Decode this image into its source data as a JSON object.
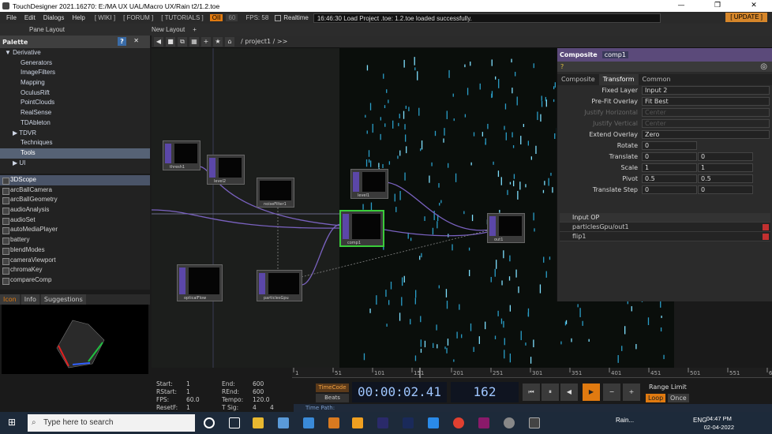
{
  "window": {
    "title": "TouchDesigner 2021.16270: E:/MA UX UAL/Macro UX/Rain t2/1.2.toe",
    "minimize": "—",
    "maximize": "❐",
    "close": "✕"
  },
  "menu": {
    "file": "File",
    "edit": "Edit",
    "dialogs": "Dialogs",
    "help": "Help",
    "wiki": "[ WIKI ]",
    "forum": "[ FORUM ]",
    "tutorials": "[ TUTORIALS ]",
    "oii": "OII",
    "sixty": "60",
    "fps": "FPS: 58",
    "realtime": "Realtime",
    "status": "16:46:30 Load Project .toe: 1.2.toe loaded successfully.",
    "update": "[ UPDATE ]"
  },
  "toolbar": {
    "pane_layout": "Pane Layout",
    "new_layout": "New Layout",
    "plus": "+"
  },
  "path": {
    "text": "/ project1 / >>"
  },
  "palette": {
    "title": "Palette",
    "q": "?",
    "groups": [
      {
        "label": "Derivative",
        "indent": "group"
      }
    ],
    "items": [
      "Generators",
      "ImageFilters",
      "Mapping",
      "OculusRift",
      "PointClouds",
      "RealSense",
      "TDAbleton"
    ],
    "tdvr": "TDVR",
    "techniques": "Techniques",
    "tools": "Tools",
    "ui": "UI"
  },
  "components": [
    "3DScope",
    "arcBallCamera",
    "arcBallGeometry",
    "audioAnalysis",
    "audioSet",
    "autoMediaPlayer",
    "battery",
    "blendModes",
    "cameraViewport",
    "chromaKey",
    "compareComp"
  ],
  "tabs": {
    "icon": "Icon",
    "info": "Info",
    "suggestions": "Suggestions"
  },
  "nodes": {
    "thresh": "thresh1",
    "level2": "level2",
    "noise": "noiseFilter1",
    "level1": "level1",
    "comp1": "comp1",
    "out1": "out1",
    "optical": "opticalFlow",
    "particles": "particlesGpu"
  },
  "param": {
    "type": "Composite",
    "name": "comp1",
    "tab_composite": "Composite",
    "tab_transform": "Transform",
    "tab_common": "Common",
    "fixed_layer_l": "Fixed Layer",
    "fixed_layer_v": "Input 2",
    "prefit_l": "Pre-Fit Overlay",
    "prefit_v": "Fit Best",
    "justh_l": "Justify Horizontal",
    "justh_v": "Center",
    "justv_l": "Justify Vertical",
    "justv_v": "Center",
    "extend_l": "Extend Overlay",
    "extend_v": "Zero",
    "rotate_l": "Rotate",
    "rotate_v": "0",
    "translate_l": "Translate",
    "translate_x": "0",
    "translate_y": "0",
    "scale_l": "Scale",
    "scale_x": "1",
    "scale_y": "1",
    "pivot_l": "Pivot",
    "pivot_x": "0.5",
    "pivot_y": "0.5",
    "tstep_l": "Translate Step",
    "tstep_x": "0",
    "tstep_y": "0",
    "input_op": "Input OP",
    "in1": "particlesGpu/out1",
    "in2": "flip1"
  },
  "timeline": {
    "ticks": [
      "1",
      "51",
      "101",
      "151",
      "201",
      "251",
      "301",
      "351",
      "401",
      "451",
      "501",
      "551",
      "600"
    ]
  },
  "info": {
    "start_l": "Start:",
    "start_v": "1",
    "end_l": "End:",
    "end_v": "600",
    "rstart_l": "RStart:",
    "rstart_v": "1",
    "rend_l": "REnd:",
    "rend_v": "600",
    "fps_l": "FPS:",
    "fps_v": "60.0",
    "tempo_l": "Tempo:",
    "tempo_v": "120.0",
    "resetf_l": "ResetF:",
    "resetf_v": "1",
    "tsig_l": "T Sig:",
    "tsig_a": "4",
    "tsig_b": "4"
  },
  "transport": {
    "timecode": "TimeCode",
    "beats": "Beats",
    "time": "00:00:02.41",
    "frame": "162",
    "range_limit": "Range Limit",
    "loop": "Loop",
    "once": "Once",
    "time_path": "Time Path:"
  },
  "taskbar": {
    "search": "Type here to search",
    "rain": "Rain...",
    "lang": "ENG",
    "time": "04:47 PM",
    "date": "02-04-2022"
  }
}
